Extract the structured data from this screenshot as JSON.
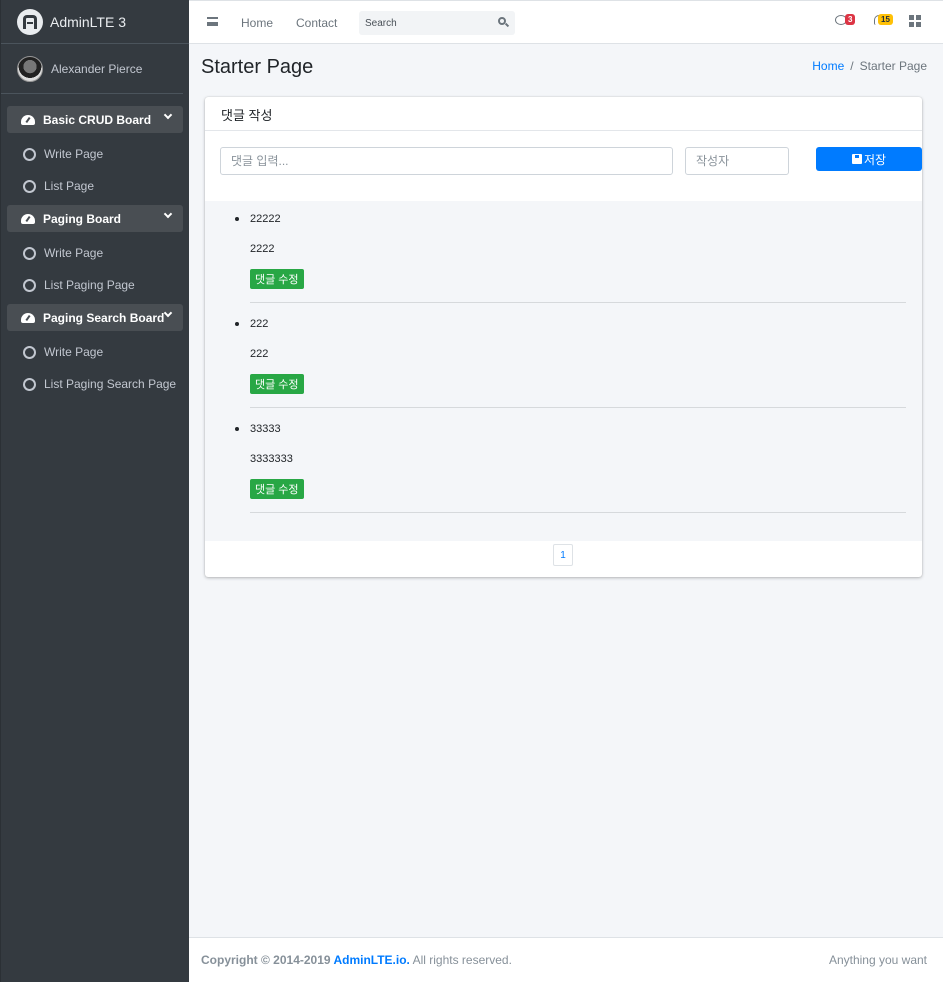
{
  "brand": {
    "name": "AdminLTE 3"
  },
  "user": {
    "name": "Alexander Pierce"
  },
  "sidebar": {
    "sections": [
      {
        "label": "Basic CRUD Board",
        "items": [
          "Write Page",
          "List Page"
        ]
      },
      {
        "label": "Paging Board",
        "items": [
          "Write Page",
          "List Paging Page"
        ]
      },
      {
        "label": "Paging Search Board",
        "items": [
          "Write Page",
          "List Paging Search Page"
        ]
      }
    ]
  },
  "topnav": {
    "home": "Home",
    "contact": "Contact",
    "search_placeholder": "Search",
    "messages_count": "3",
    "notifications_count": "15"
  },
  "page": {
    "title": "Starter Page",
    "breadcrumb": {
      "home": "Home",
      "current": "Starter Page"
    }
  },
  "card": {
    "title": "댓글 작성",
    "comment_placeholder": "댓글 입력...",
    "writer_placeholder": "작성자",
    "save_label": "저장",
    "replies": [
      {
        "title": "22222",
        "text": "2222",
        "edit_label": "댓글 수정"
      },
      {
        "title": "222",
        "text": "222",
        "edit_label": "댓글 수정"
      },
      {
        "title": "33333",
        "text": "3333333",
        "edit_label": "댓글 수정"
      }
    ],
    "pagination": [
      "1"
    ]
  },
  "footer": {
    "copyright_prefix": "Copyright © 2014-2019 ",
    "copyright_link": "AdminLTE.io.",
    "copyright_suffix": " All rights reserved.",
    "right_text": "Anything you want"
  },
  "colors": {
    "sidebar_bg": "#343a40",
    "primary": "#007bff",
    "success": "#28a745",
    "danger": "#dc3545",
    "warning": "#ffc107"
  }
}
